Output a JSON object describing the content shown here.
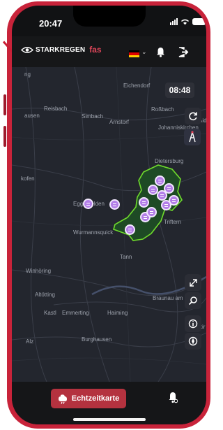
{
  "status_bar": {
    "time": "20:47"
  },
  "app_bar": {
    "logo_text": "STARKREGEN",
    "logo_suffix": "fas",
    "language_flag": "de-flag-icon",
    "notification_icon": "bell-icon",
    "logout_icon": "logout-icon"
  },
  "map": {
    "time_display": "08:48",
    "place_names": [
      "Eichendorf",
      "Reisbach",
      "Roßbach",
      "Simbach",
      "Arnstorf",
      "Aide",
      "Johanniskirchen",
      "Dietersburg",
      "Eggenfelden",
      "Triftern",
      "Wurmannsquick",
      "Tann",
      "Winhöring",
      "Altötting",
      "Braunau am Inn",
      "Kastl",
      "Emmerting",
      "Haiming",
      "Burghausen",
      "Alz",
      "kofen",
      "ausen",
      "kir",
      "ng"
    ],
    "controls": [
      "refresh-icon",
      "tower-icon",
      "expand-icon",
      "search-icon",
      "info-icon",
      "compass-icon"
    ],
    "warning_markers_count": 12,
    "colors": {
      "region_fill": "#1e4a25",
      "region_border": "#6fdc2c",
      "marker": "#b37ee8"
    }
  },
  "bottom_nav": {
    "realtime_label": "Echtzeitkarte",
    "realtime_icon": "realtime-map-icon",
    "alerts_icon": "bell-settings-icon"
  },
  "colors": {
    "accent": "#b4323f",
    "phone_frame": "#c8233a",
    "map_bg": "#23262e"
  }
}
